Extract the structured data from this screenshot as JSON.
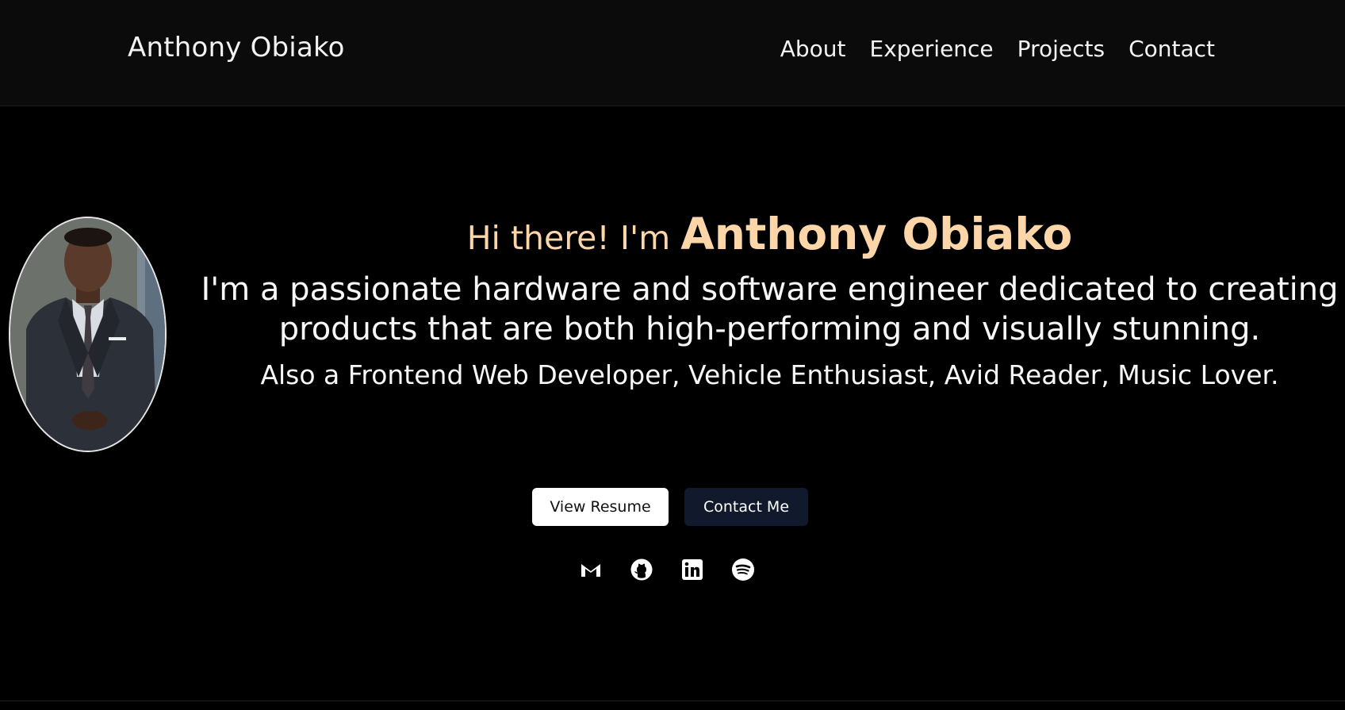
{
  "header": {
    "brand": "Anthony Obiako",
    "nav": [
      "About",
      "Experience",
      "Projects",
      "Contact"
    ]
  },
  "hero": {
    "greeting_prefix": "Hi there! I'm ",
    "name": "Anthony Obiako",
    "tagline": "I'm a passionate hardware and software engineer dedicated to creating products that are both high-performing and visually stunning.",
    "also": "Also a Frontend Web Developer, Vehicle Enthusiast, Avid Reader, Music Lover.",
    "buttons": {
      "resume": "View Resume",
      "contact": "Contact Me"
    },
    "socials": [
      "gmail-icon",
      "github-icon",
      "linkedin-icon",
      "spotify-icon"
    ]
  },
  "colors": {
    "accent": "#fcd6a8",
    "nav_bg": "#0b0b0b",
    "page_bg": "#000000",
    "dark_button": "#101a2c"
  }
}
